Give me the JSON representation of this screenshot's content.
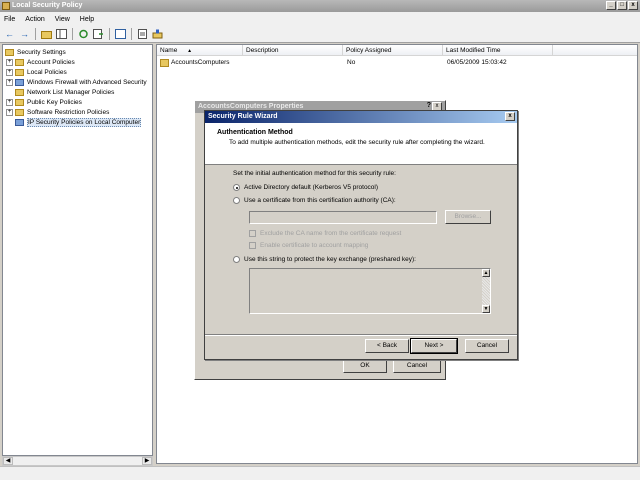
{
  "window": {
    "title": "Local Security Policy",
    "min": "_",
    "max": "□",
    "close": "x"
  },
  "menu": [
    "File",
    "Action",
    "View",
    "Help"
  ],
  "toolbar": {
    "back": "←",
    "forward": "→"
  },
  "tree": {
    "root": "Security Settings",
    "items": [
      {
        "label": "Account Policies",
        "expand": "+"
      },
      {
        "label": "Local Policies",
        "expand": "+"
      },
      {
        "label": "Windows Firewall with Advanced Security",
        "expand": "+"
      },
      {
        "label": "Network List Manager Policies",
        "expand": ""
      },
      {
        "label": "Public Key Policies",
        "expand": "+"
      },
      {
        "label": "Software Restriction Policies",
        "expand": "+"
      },
      {
        "label": "IP Security Policies on Local Computer",
        "expand": ""
      }
    ]
  },
  "list": {
    "columns": [
      "Name",
      "Description",
      "Policy Assigned",
      "Last Modified Time"
    ],
    "sort_indicator": "▲",
    "rows": [
      {
        "name": "AccountsComputers",
        "description": "",
        "assigned": "No",
        "modified": "06/05/2009 15:03:42"
      }
    ]
  },
  "scroll": {
    "left": "◀",
    "right": "▶"
  },
  "props_dialog": {
    "title": "AccountsComputers Properties",
    "help": "?",
    "close": "x",
    "ok": "OK",
    "cancel": "Cancel"
  },
  "wizard": {
    "title": "Security Rule Wizard",
    "close": "x",
    "heading": "Authentication Method",
    "description": "To add multiple authentication methods, edit the security rule after completing the wizard.",
    "prompt": "Set the initial authentication method for this security rule:",
    "option_ad": "Active Directory default (Kerberos V5 protocol)",
    "option_cert": "Use a certificate from this certification authority (CA):",
    "cert_value": "",
    "browse": "Browse...",
    "check_exclude": "Exclude the CA name from the certificate request",
    "check_mapping": "Enable certificate to account mapping",
    "option_psk": "Use this string to protect the key exchange (preshared key):",
    "psk_value": "",
    "scroll_up": "▲",
    "scroll_down": "▼",
    "back": "< Back",
    "next": "Next >",
    "cancel": "Cancel"
  }
}
